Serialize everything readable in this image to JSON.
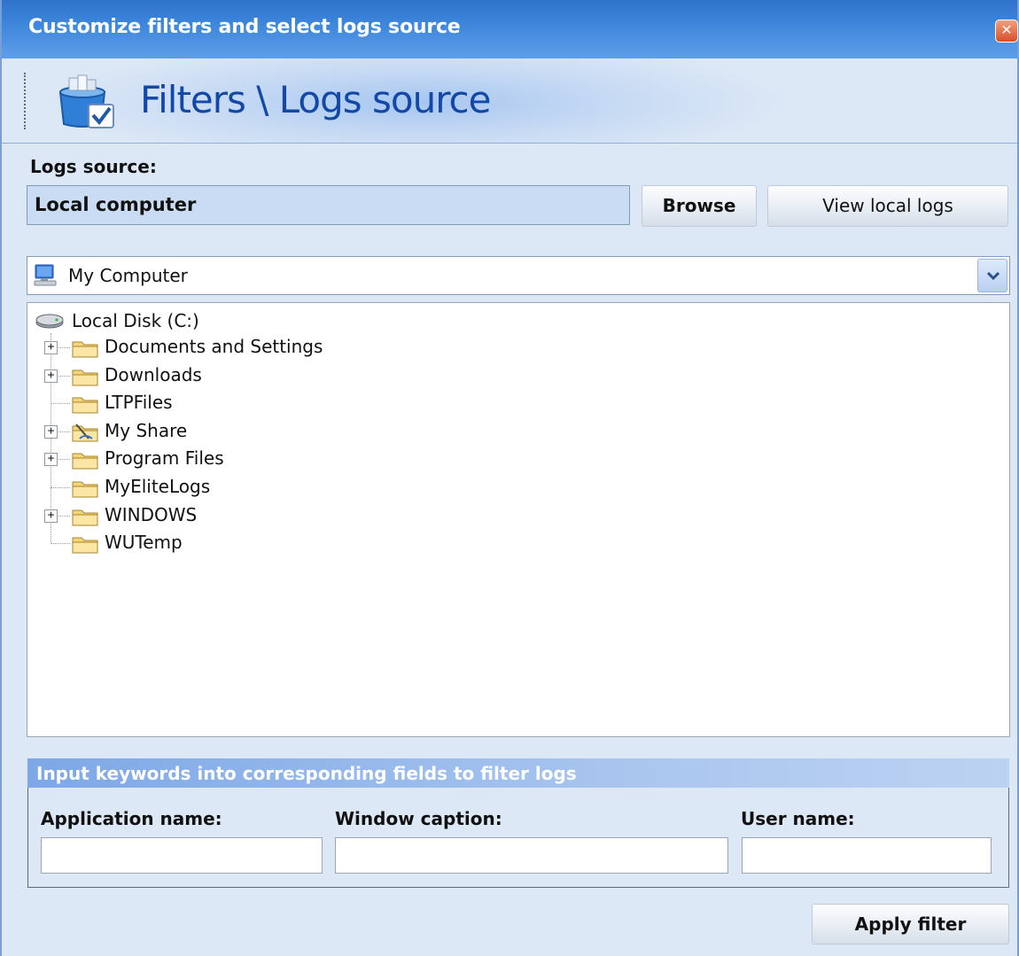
{
  "window": {
    "title": "Customize filters and select logs source",
    "close_glyph": "✕"
  },
  "banner": {
    "title": "Filters \\ Logs source",
    "icon": "filter-box-check-icon"
  },
  "logs_source": {
    "label": "Logs source:",
    "value": "Local computer",
    "browse_label": "Browse",
    "view_local_label": "View local logs"
  },
  "location_combo": {
    "icon": "my-computer-icon",
    "selected": "My Computer"
  },
  "tree": {
    "root": {
      "label": "Local Disk  (C:)",
      "icon": "hard-disk-icon"
    },
    "items": [
      {
        "label": "Documents and Settings",
        "expandable": true,
        "icon": "folder-icon"
      },
      {
        "label": "Downloads",
        "expandable": true,
        "icon": "folder-icon"
      },
      {
        "label": "LTPFiles",
        "expandable": false,
        "icon": "folder-icon"
      },
      {
        "label": "My Share",
        "expandable": true,
        "icon": "shared-folder-icon"
      },
      {
        "label": "Program Files",
        "expandable": true,
        "icon": "folder-icon"
      },
      {
        "label": "MyEliteLogs",
        "expandable": false,
        "icon": "folder-icon"
      },
      {
        "label": "WINDOWS",
        "expandable": true,
        "icon": "folder-icon"
      },
      {
        "label": "WUTemp",
        "expandable": false,
        "icon": "folder-icon"
      }
    ],
    "expander_glyph": "+"
  },
  "filters": {
    "header": "Input keywords into corresponding fields to filter logs",
    "application_label": "Application name:",
    "application_value": "",
    "window_label": "Window caption:",
    "window_value": "",
    "user_label": "User name:",
    "user_value": ""
  },
  "apply_label": "Apply filter",
  "colors": {
    "title_bar": "#3d86db",
    "banner_title": "#1248a8",
    "group_header": "#7da8e6"
  }
}
